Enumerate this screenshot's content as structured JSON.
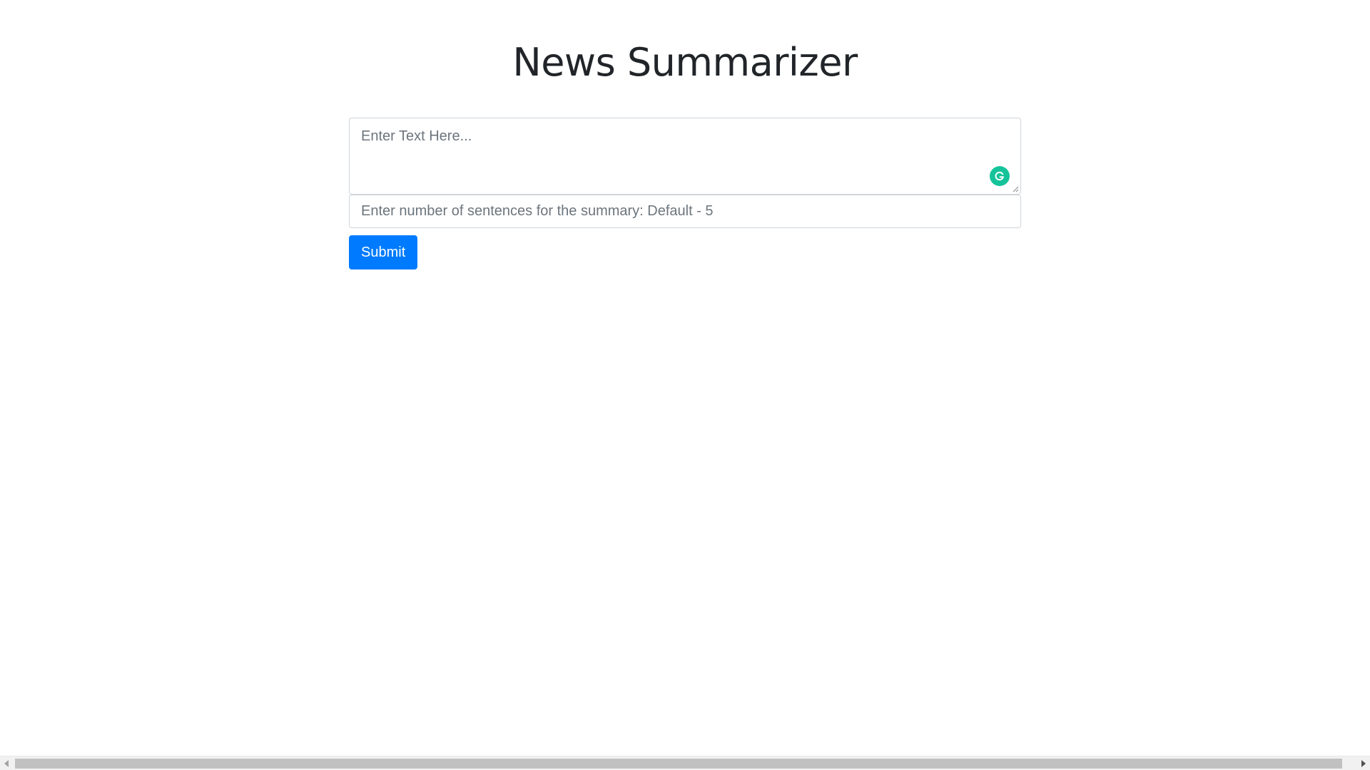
{
  "page": {
    "title": "News Summarizer"
  },
  "form": {
    "text_placeholder": "Enter Text Here...",
    "text_value": "",
    "sentences_placeholder": "Enter number of sentences for the summary: Default - 5",
    "sentences_value": "",
    "submit_label": "Submit"
  },
  "icons": {
    "grammarly": "grammarly-icon",
    "resize": "resize-handle-icon",
    "scroll_left": "scroll-left-arrow-icon",
    "scroll_right": "scroll-right-arrow-icon"
  },
  "colors": {
    "accent": "#007bff",
    "grammarly": "#15c39a",
    "title": "#212529",
    "placeholder": "#6c757d"
  }
}
